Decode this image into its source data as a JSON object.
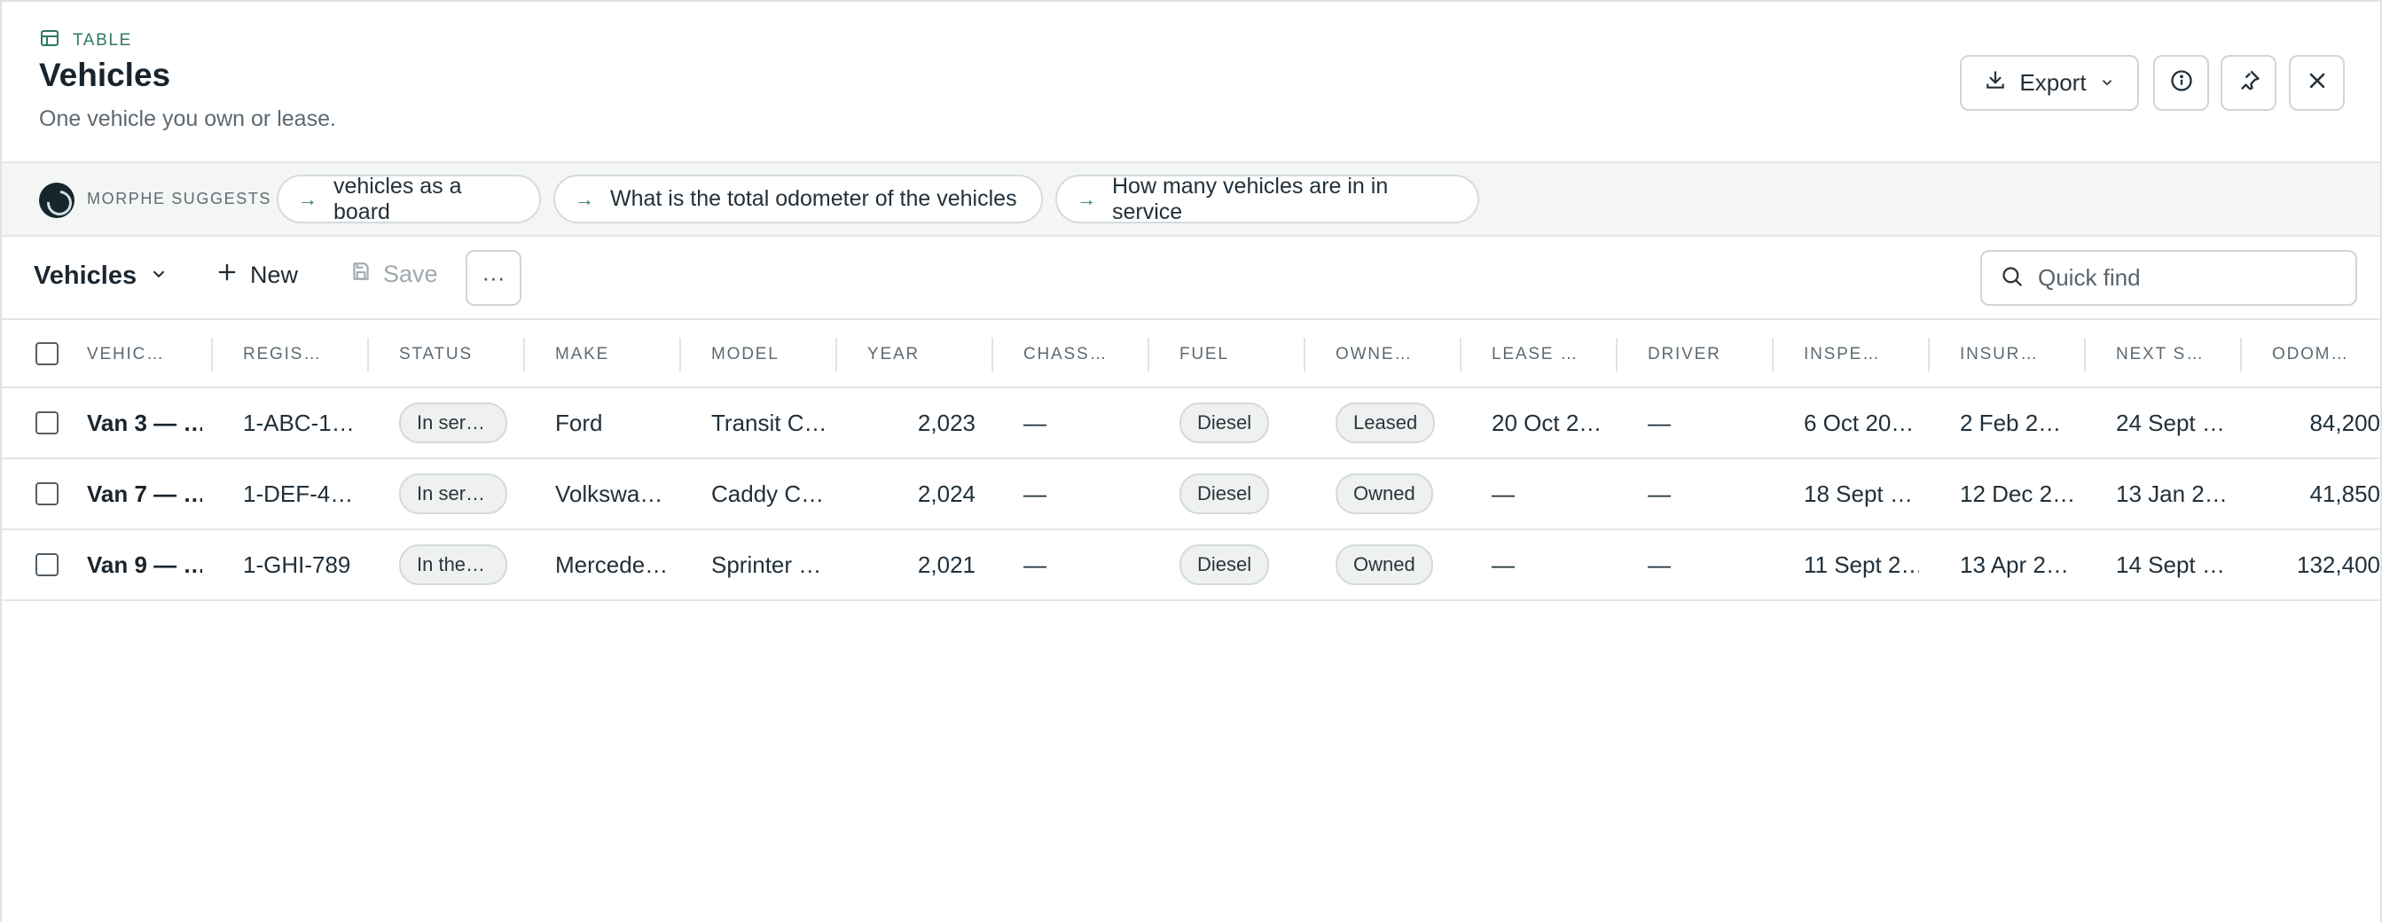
{
  "header": {
    "kicker": "TABLE",
    "title": "Vehicles",
    "subtitle": "One vehicle you own or lease.",
    "export_label": "Export"
  },
  "suggestions": {
    "label": "MORPHE SUGGESTS",
    "chips": [
      "vehicles as a board",
      "What is the total odometer of the vehicles",
      "How many vehicles are in in service"
    ]
  },
  "toolbar": {
    "view_label": "Vehicles",
    "new_label": "New",
    "save_label": "Save",
    "more_label": "···",
    "search_placeholder": "Quick find"
  },
  "table": {
    "columns": [
      "VEHIC…",
      "REGIS…",
      "STATUS",
      "MAKE",
      "MODEL",
      "YEAR",
      "CHASS…",
      "FUEL",
      "OWNE…",
      "LEASE …",
      "DRIVER",
      "INSPE…",
      "INSUR…",
      "NEXT S…",
      "ODOM…"
    ],
    "rows": [
      {
        "vehicle": "Van 3 — …",
        "registration": "1-ABC-1…",
        "status": "In ser…",
        "make": "Ford",
        "model": "Transit C…",
        "year": "2,023",
        "chassis": "—",
        "fuel": "Diesel",
        "ownership": "Leased",
        "lease": "20 Oct 2…",
        "driver": "—",
        "inspection": "6 Oct 20…",
        "insurance": "2 Feb 2…",
        "next_service": "24 Sept …",
        "odometer": "84,200"
      },
      {
        "vehicle": "Van 7 — …",
        "registration": "1-DEF-4…",
        "status": "In ser…",
        "make": "Volkswa…",
        "model": "Caddy C…",
        "year": "2,024",
        "chassis": "—",
        "fuel": "Diesel",
        "ownership": "Owned",
        "lease": "—",
        "driver": "—",
        "inspection": "18 Sept …",
        "insurance": "12 Dec 2…",
        "next_service": "13 Jan 2…",
        "odometer": "41,850"
      },
      {
        "vehicle": "Van 9 — …",
        "registration": "1-GHI-789",
        "status": "In the …",
        "make": "Mercede…",
        "model": "Sprinter …",
        "year": "2,021",
        "chassis": "—",
        "fuel": "Diesel",
        "ownership": "Owned",
        "lease": "—",
        "driver": "—",
        "inspection": "11 Sept 2…",
        "insurance": "13 Apr 2…",
        "next_service": "14 Sept …",
        "odometer": "132,400"
      }
    ]
  }
}
